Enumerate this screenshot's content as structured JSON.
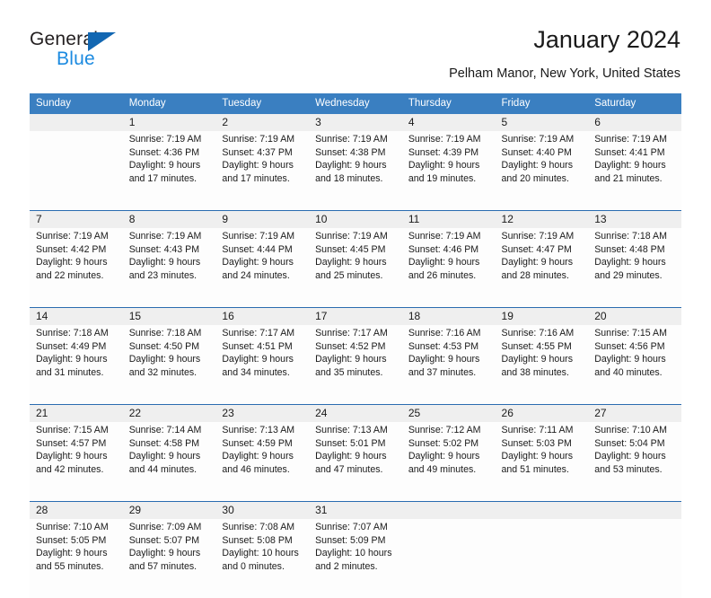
{
  "brand": {
    "name_part1": "General",
    "name_part2": "Blue",
    "primary_color": "#1267b2",
    "accent_color": "#1b8ae0"
  },
  "header": {
    "title": "January 2024",
    "location": "Pelham Manor, New York, United States"
  },
  "theme": {
    "header_bg": "#3a7fc1",
    "date_bg": "#efefef",
    "cell_bg": "#fdfdfd",
    "divider": "#2a6cb0"
  },
  "weekday_headers": [
    "Sunday",
    "Monday",
    "Tuesday",
    "Wednesday",
    "Thursday",
    "Friday",
    "Saturday"
  ],
  "weeks": [
    [
      {
        "day": "",
        "lines": []
      },
      {
        "day": "1",
        "lines": [
          "Sunrise: 7:19 AM",
          "Sunset: 4:36 PM",
          "Daylight: 9 hours",
          "and 17 minutes."
        ]
      },
      {
        "day": "2",
        "lines": [
          "Sunrise: 7:19 AM",
          "Sunset: 4:37 PM",
          "Daylight: 9 hours",
          "and 17 minutes."
        ]
      },
      {
        "day": "3",
        "lines": [
          "Sunrise: 7:19 AM",
          "Sunset: 4:38 PM",
          "Daylight: 9 hours",
          "and 18 minutes."
        ]
      },
      {
        "day": "4",
        "lines": [
          "Sunrise: 7:19 AM",
          "Sunset: 4:39 PM",
          "Daylight: 9 hours",
          "and 19 minutes."
        ]
      },
      {
        "day": "5",
        "lines": [
          "Sunrise: 7:19 AM",
          "Sunset: 4:40 PM",
          "Daylight: 9 hours",
          "and 20 minutes."
        ]
      },
      {
        "day": "6",
        "lines": [
          "Sunrise: 7:19 AM",
          "Sunset: 4:41 PM",
          "Daylight: 9 hours",
          "and 21 minutes."
        ]
      }
    ],
    [
      {
        "day": "7",
        "lines": [
          "Sunrise: 7:19 AM",
          "Sunset: 4:42 PM",
          "Daylight: 9 hours",
          "and 22 minutes."
        ]
      },
      {
        "day": "8",
        "lines": [
          "Sunrise: 7:19 AM",
          "Sunset: 4:43 PM",
          "Daylight: 9 hours",
          "and 23 minutes."
        ]
      },
      {
        "day": "9",
        "lines": [
          "Sunrise: 7:19 AM",
          "Sunset: 4:44 PM",
          "Daylight: 9 hours",
          "and 24 minutes."
        ]
      },
      {
        "day": "10",
        "lines": [
          "Sunrise: 7:19 AM",
          "Sunset: 4:45 PM",
          "Daylight: 9 hours",
          "and 25 minutes."
        ]
      },
      {
        "day": "11",
        "lines": [
          "Sunrise: 7:19 AM",
          "Sunset: 4:46 PM",
          "Daylight: 9 hours",
          "and 26 minutes."
        ]
      },
      {
        "day": "12",
        "lines": [
          "Sunrise: 7:19 AM",
          "Sunset: 4:47 PM",
          "Daylight: 9 hours",
          "and 28 minutes."
        ]
      },
      {
        "day": "13",
        "lines": [
          "Sunrise: 7:18 AM",
          "Sunset: 4:48 PM",
          "Daylight: 9 hours",
          "and 29 minutes."
        ]
      }
    ],
    [
      {
        "day": "14",
        "lines": [
          "Sunrise: 7:18 AM",
          "Sunset: 4:49 PM",
          "Daylight: 9 hours",
          "and 31 minutes."
        ]
      },
      {
        "day": "15",
        "lines": [
          "Sunrise: 7:18 AM",
          "Sunset: 4:50 PM",
          "Daylight: 9 hours",
          "and 32 minutes."
        ]
      },
      {
        "day": "16",
        "lines": [
          "Sunrise: 7:17 AM",
          "Sunset: 4:51 PM",
          "Daylight: 9 hours",
          "and 34 minutes."
        ]
      },
      {
        "day": "17",
        "lines": [
          "Sunrise: 7:17 AM",
          "Sunset: 4:52 PM",
          "Daylight: 9 hours",
          "and 35 minutes."
        ]
      },
      {
        "day": "18",
        "lines": [
          "Sunrise: 7:16 AM",
          "Sunset: 4:53 PM",
          "Daylight: 9 hours",
          "and 37 minutes."
        ]
      },
      {
        "day": "19",
        "lines": [
          "Sunrise: 7:16 AM",
          "Sunset: 4:55 PM",
          "Daylight: 9 hours",
          "and 38 minutes."
        ]
      },
      {
        "day": "20",
        "lines": [
          "Sunrise: 7:15 AM",
          "Sunset: 4:56 PM",
          "Daylight: 9 hours",
          "and 40 minutes."
        ]
      }
    ],
    [
      {
        "day": "21",
        "lines": [
          "Sunrise: 7:15 AM",
          "Sunset: 4:57 PM",
          "Daylight: 9 hours",
          "and 42 minutes."
        ]
      },
      {
        "day": "22",
        "lines": [
          "Sunrise: 7:14 AM",
          "Sunset: 4:58 PM",
          "Daylight: 9 hours",
          "and 44 minutes."
        ]
      },
      {
        "day": "23",
        "lines": [
          "Sunrise: 7:13 AM",
          "Sunset: 4:59 PM",
          "Daylight: 9 hours",
          "and 46 minutes."
        ]
      },
      {
        "day": "24",
        "lines": [
          "Sunrise: 7:13 AM",
          "Sunset: 5:01 PM",
          "Daylight: 9 hours",
          "and 47 minutes."
        ]
      },
      {
        "day": "25",
        "lines": [
          "Sunrise: 7:12 AM",
          "Sunset: 5:02 PM",
          "Daylight: 9 hours",
          "and 49 minutes."
        ]
      },
      {
        "day": "26",
        "lines": [
          "Sunrise: 7:11 AM",
          "Sunset: 5:03 PM",
          "Daylight: 9 hours",
          "and 51 minutes."
        ]
      },
      {
        "day": "27",
        "lines": [
          "Sunrise: 7:10 AM",
          "Sunset: 5:04 PM",
          "Daylight: 9 hours",
          "and 53 minutes."
        ]
      }
    ],
    [
      {
        "day": "28",
        "lines": [
          "Sunrise: 7:10 AM",
          "Sunset: 5:05 PM",
          "Daylight: 9 hours",
          "and 55 minutes."
        ]
      },
      {
        "day": "29",
        "lines": [
          "Sunrise: 7:09 AM",
          "Sunset: 5:07 PM",
          "Daylight: 9 hours",
          "and 57 minutes."
        ]
      },
      {
        "day": "30",
        "lines": [
          "Sunrise: 7:08 AM",
          "Sunset: 5:08 PM",
          "Daylight: 10 hours",
          "and 0 minutes."
        ]
      },
      {
        "day": "31",
        "lines": [
          "Sunrise: 7:07 AM",
          "Sunset: 5:09 PM",
          "Daylight: 10 hours",
          "and 2 minutes."
        ]
      },
      {
        "day": "",
        "lines": []
      },
      {
        "day": "",
        "lines": []
      },
      {
        "day": "",
        "lines": []
      }
    ]
  ]
}
